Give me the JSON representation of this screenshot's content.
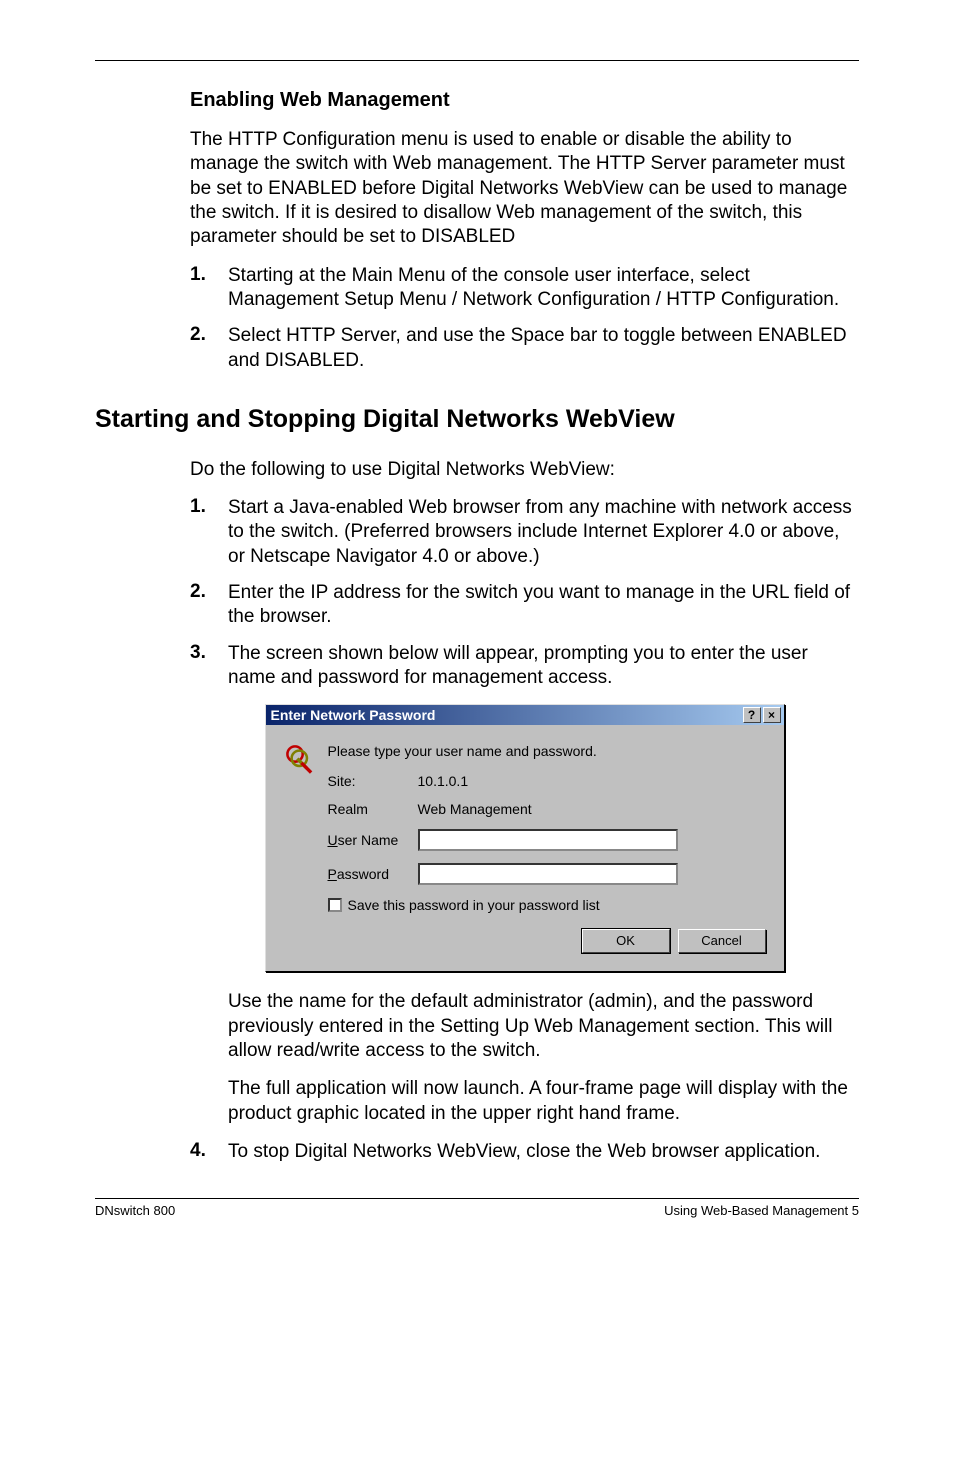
{
  "subhead": "Enabling Web Management",
  "para1": "The HTTP Configuration menu is used to enable or disable the ability to manage the switch with Web management. The HTTP Server parameter must be set to ENABLED before Digital Networks WebView can be used to manage the switch. If it is desired to disallow Web management of the switch, this parameter should be set to DISABLED",
  "list1": {
    "item1_num": "1.",
    "item1_text": "Starting at the Main Menu of the console user interface, select Management Setup Menu / Network Configuration / HTTP Configuration.",
    "item2_num": "2.",
    "item2_text": "Select HTTP Server, and use the Space bar to toggle between ENABLED and DISABLED."
  },
  "section_head": "Starting and Stopping Digital Networks WebView",
  "para2": "Do the following to use Digital Networks WebView:",
  "list2": {
    "item1_num": "1.",
    "item1_text": "Start a Java-enabled Web browser from any machine with network access to the switch. (Preferred browsers include Internet Explorer 4.0 or above, or Netscape Navigator 4.0 or above.)",
    "item2_num": "2.",
    "item2_text": "Enter the IP address for the switch you want to manage in the URL field of the browser.",
    "item3_num": "3.",
    "item3_text": "The screen shown below will appear, prompting you to enter the user name and password for management access."
  },
  "dialog": {
    "title": "Enter Network Password",
    "help_btn": "?",
    "close_btn": "×",
    "prompt": "Please type your user name and password.",
    "site_label": "Site:",
    "site_value": "10.1.0.1",
    "realm_label": "Realm",
    "realm_value": "Web Management",
    "username_label_u": "U",
    "username_label_rest": "ser Name",
    "username_value": "",
    "password_label_u": "P",
    "password_label_rest": "assword",
    "password_value": "",
    "save_check_u": "S",
    "save_check_rest": "ave this password in your password list",
    "ok_btn": "OK",
    "cancel_btn": "Cancel"
  },
  "after_dialog_p1": "Use the name for the default administrator (admin), and the password previously entered in the Setting Up Web Management section. This will allow read/write access to the switch.",
  "after_dialog_p2": "The full application will now launch. A four-frame page will display with the product graphic located in the upper right hand frame.",
  "list3": {
    "item4_num": "4.",
    "item4_text": "To stop Digital Networks WebView, close the Web browser application."
  },
  "footer_left": "DNswitch 800",
  "footer_right": "Using Web-Based Management  5"
}
